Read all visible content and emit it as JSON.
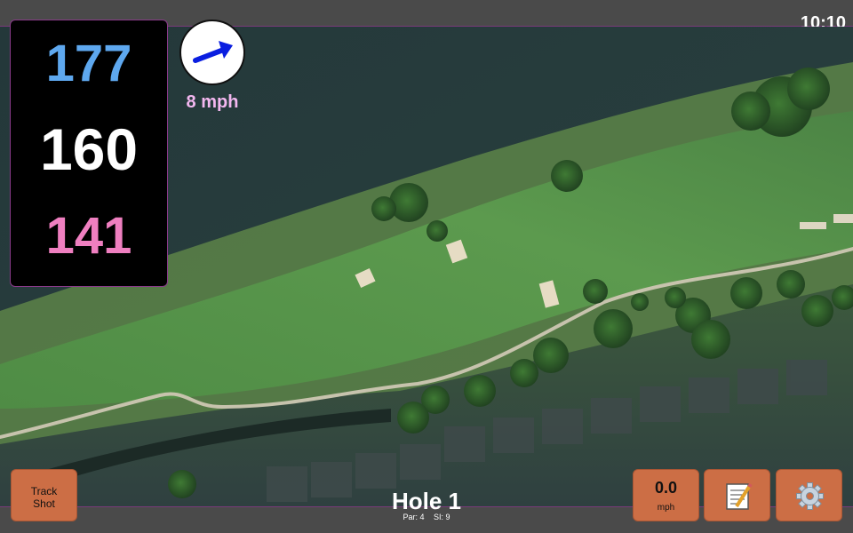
{
  "status_bar": {
    "time": "10:10"
  },
  "distances": {
    "back": "177",
    "middle": "160",
    "front": "141"
  },
  "wind": {
    "speed_label": "8 mph",
    "direction_icon": "wind-arrow-icon"
  },
  "buttons": {
    "track_shot_line1": "Track",
    "track_shot_line2": "Shot",
    "speed_value": "0.0",
    "speed_unit": "mph",
    "notes_icon": "notepad-icon",
    "settings_icon": "gear-icon"
  },
  "hole": {
    "title": "Hole 1",
    "par_label": "Par: 4",
    "si_label": "SI: 9"
  },
  "colors": {
    "back_distance": "#5ea8ef",
    "middle_distance": "#ffffff",
    "front_distance": "#ef7fc0",
    "wind_label": "#f3b7f0",
    "button_fill": "#cc6e45",
    "wind_arrow": "#0a1ee0"
  }
}
